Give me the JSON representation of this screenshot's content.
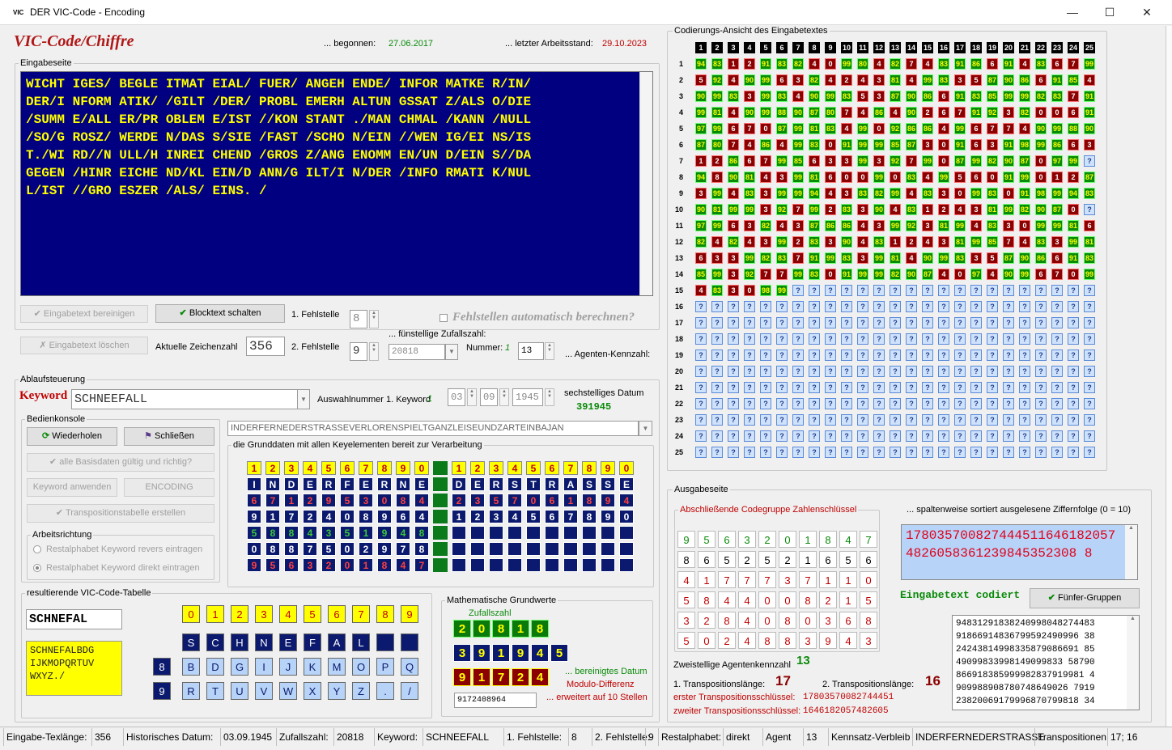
{
  "window": {
    "logo": "VIC",
    "title": "DER VIC-Code - Encoding"
  },
  "header": {
    "app_title": "VIC-Code/Chiffre",
    "begun_label": "... begonnen:",
    "begun_date": "27.06.2017",
    "last_label": "... letzter Arbeitsstand:",
    "last_date": "29.10.2023"
  },
  "input": {
    "group_label": "Eingabeseite",
    "lines": [
      "WICHT IGES/ BEGLE ITMAT EIAL/ FUER/ ANGEH ENDE/ INFOR MATKE R/IN/",
      "DER/I NFORM ATIK/ /GILT /DER/ PROBL EMERH ALTUN GSSAT Z/ALS O/DIE",
      "/SUMM E/ALL ER/PR OBLEM E/IST //KON STANT ./MAN CHMAL /KANN /NULL",
      "/SO/G ROSZ/ WERDE N/DAS S/SIE /FAST /SCHO N/EIN //WEN IG/EI NS/IS",
      "T./WI RD//N ULL/H INREI CHEND /GROS Z/ANG ENOMM EN/UN D/EIN S//DA",
      "GEGEN /HINR EICHE ND/KL EIN/D ANN/G ILT/I N/DER /INFO RMATI K/NUL",
      "L/IST //GRO ESZER /ALS/ EINS. /"
    ]
  },
  "controls": {
    "clean_btn": "Eingabetext bereinigen",
    "block_btn": "Blocktext schalten",
    "delete_btn": "Eingabetext löschen",
    "count_label": "Aktuelle Zeichenzahl",
    "count_value": "356",
    "err1_label": "1. Fehlstelle",
    "err1_value": "8",
    "err2_label": "2. Fehlstelle",
    "err2_value": "9",
    "auto_label": "Fehlstellen automatisch berechnen?",
    "random_label": "... fünstellige Zufallszahl:",
    "random_value": "20818",
    "number_label": "Nummer:",
    "number_value": "1",
    "agent_value": "13",
    "agent_label": "... Agenten-Kennzahl:"
  },
  "flow": {
    "group_label": "Ablaufsteuerung",
    "keyword_label": "Keyword",
    "keyword_value": "SCHNEEFALL",
    "select_label": "Auswahlnummer 1. Keyword",
    "select_value": "1",
    "date_d": "03",
    "date_m": "09",
    "date_y": "1945",
    "date_label": "sechstelliges Datum",
    "date_code": "391945",
    "phrase": "INDERFERNEDERSTRASSEVERLORENSPIELTGANZLEISEUNDZARTEINBAJAN"
  },
  "console": {
    "group_label": "Bedienkonsole",
    "repeat_btn": "Wiederholen",
    "close_btn": "Schließen",
    "check_btn": "alle Basisdaten gültig und richtig?",
    "apply_btn": "Keyword anwenden",
    "encode_btn": "ENCODING",
    "trans_btn": "Transpositionstabelle erstellen",
    "dir_label": "Arbeitsrichtung",
    "dir_rev": "Restalphabet Keyword revers eintragen",
    "dir_fwd": "Restalphabet Keyword direkt eintragen"
  },
  "basedata": {
    "label": "die Grunddaten mit allen Keyelementen bereit zur Verarbeitung",
    "rows": [
      [
        "1",
        "2",
        "3",
        "4",
        "5",
        "6",
        "7",
        "8",
        "9",
        "0",
        "",
        "1",
        "2",
        "3",
        "4",
        "5",
        "6",
        "7",
        "8",
        "9",
        "0"
      ],
      [
        "I",
        "N",
        "D",
        "E",
        "R",
        "F",
        "E",
        "R",
        "N",
        "E",
        "",
        "D",
        "E",
        "R",
        "S",
        "T",
        "R",
        "A",
        "S",
        "S",
        "E"
      ],
      [
        "6",
        "7",
        "1",
        "2",
        "9",
        "5",
        "3",
        "0",
        "8",
        "4",
        "",
        "2",
        "3",
        "5",
        "7",
        "0",
        "6",
        "1",
        "8",
        "9",
        "4"
      ],
      [
        "9",
        "1",
        "7",
        "2",
        "4",
        "0",
        "8",
        "9",
        "6",
        "4",
        "",
        "1",
        "2",
        "3",
        "4",
        "5",
        "6",
        "7",
        "8",
        "9",
        "0"
      ],
      [
        "5",
        "8",
        "8",
        "4",
        "3",
        "5",
        "1",
        "9",
        "4",
        "8",
        "",
        "",
        "",
        "",
        "",
        "",
        "",
        "",
        "",
        "",
        ""
      ],
      [
        "0",
        "8",
        "8",
        "7",
        "5",
        "0",
        "2",
        "9",
        "7",
        "8",
        "",
        "",
        "",
        "",
        "",
        "",
        "",
        "",
        "",
        "",
        ""
      ],
      [
        "9",
        "5",
        "6",
        "3",
        "2",
        "0",
        "1",
        "8",
        "4",
        "7",
        "",
        "",
        "",
        "",
        "",
        "",
        "",
        "",
        "",
        "",
        ""
      ]
    ]
  },
  "victable": {
    "group_label": "resultierende VIC-Code-Tabelle",
    "keyword": "SCHNEFAL",
    "alphabet": "SCHNEFALBDG IJKMOPQRTUV WXYZ./",
    "digits": [
      "0",
      "1",
      "2",
      "3",
      "4",
      "5",
      "6",
      "7",
      "8",
      "9"
    ],
    "row1": [
      "S",
      "C",
      "H",
      "N",
      "E",
      "F",
      "A",
      "L",
      "",
      ""
    ],
    "row2_num": "8",
    "row2": [
      "B",
      "D",
      "G",
      "I",
      "J",
      "K",
      "M",
      "O",
      "P",
      "Q"
    ],
    "row3_num": "9",
    "row3": [
      "R",
      "T",
      "U",
      "V",
      "W",
      "X",
      "Y",
      "Z",
      ".",
      "/"
    ]
  },
  "math": {
    "group_label": "Mathematische Grundwerte",
    "random_label": "Zufallszahl",
    "row1": [
      "2",
      "0",
      "8",
      "1",
      "8"
    ],
    "row2": [
      "3",
      "9",
      "1",
      "9",
      "4",
      "5"
    ],
    "row3": [
      "9",
      "1",
      "7",
      "2",
      "4"
    ],
    "cleaned_label": "... bereinigtes Datum",
    "modulo_label": "Modulo-Differenz",
    "extended_value": "9172408964",
    "extended_label": "... erweitert auf 10 Stellen"
  },
  "coding": {
    "group_label": "Codierungs-Ansicht des Eingabetextes",
    "headers": [
      "1",
      "2",
      "3",
      "4",
      "5",
      "6",
      "7",
      "8",
      "9",
      "10",
      "11",
      "12",
      "13",
      "14",
      "15",
      "16",
      "17",
      "18",
      "19",
      "20",
      "21",
      "22",
      "23",
      "24",
      "25"
    ],
    "row_nums": [
      "1",
      "2",
      "3",
      "4",
      "5",
      "6",
      "7",
      "8",
      "9",
      "10",
      "11",
      "12",
      "13",
      "14",
      "15",
      "16",
      "17",
      "18",
      "19",
      "20",
      "21",
      "22",
      "23",
      "24",
      "25"
    ],
    "rows": [
      "94 83 1 2 91 83 82 4 0 99 80 4 82 7 4 83 91 86 6 91 4 83 6 7 99",
      "5 92 4 90 99 6 3 82 4 2 4 3 81 4 99 83 3 5 87 90 86 6 91 85 4",
      "90 99 83 3 99 83 4 90 99 83 5 3 87 90 86 6 91 83 85 99 99 82 83 7 91",
      "99 81 4 90 99 88 90 87 80 7 4 86 4 90 2 6 7 91 92 3 82 0 0 6 91",
      "97 99 6 7 0 87 99 81 83 4 99 0 92 86 86 4 99 6 7 7 4 90 99 88 90",
      "87 80 7 4 86 4 99 83 0 91 99 99 85 87 3 0 91 6 3 91 98 99 86 6 3",
      "1 2 86 6 7 99 85 6 3 3 99 3 92 7 99 0 87 99 82 90 87 0 97 99",
      "94 8 90 81 4 3 99 81 6 0 0 99 0 83 4 99 5 6 0 91 99 0 1 2 87",
      "3 99 4 83 3 99 99 94 4 3 83 82 99 4 83 3 0 99 83 0 91 98 99 94 83",
      "90 81 99 99 3 92 7 99 2 83 3 90 4 83 1 2 4 3 81 99 82 90 87 0",
      "97 99 6 3 82 4 3 87 86 86 4 3 99 92 3 81 99 4 83 3 0 99 99 81 6",
      "82 4 82 4 3 99 2 83 3 90 4 83 1 2 4 3 81 99 85 7 4 83 3 99 81",
      "6 3 3 99 82 83 7 91 99 83 3 99 81 4 90 99 83 3 5 87 90 86 6 91 83",
      "85 99 3 92 7 7 99 83 0 91 99 99 82 90 87 4 0 97 4 90 99 6 7 0 99",
      "4 83 3 0 98 99"
    ],
    "unknown_glyph": "?"
  },
  "output": {
    "group_label": "Ausgabeseite",
    "final_label": "Abschließende Codegruppe Zahlenschlüssel",
    "final_rows": [
      [
        "9",
        "5",
        "6",
        "3",
        "2",
        "0",
        "1",
        "8",
        "4",
        "7"
      ],
      [
        "8",
        "6",
        "5",
        "2",
        "5",
        "2",
        "1",
        "6",
        "5",
        "6"
      ],
      [
        "4",
        "1",
        "7",
        "7",
        "7",
        "3",
        "7",
        "1",
        "1",
        "0"
      ],
      [
        "5",
        "8",
        "4",
        "4",
        "0",
        "0",
        "8",
        "2",
        "1",
        "5"
      ],
      [
        "3",
        "2",
        "8",
        "4",
        "0",
        "8",
        "0",
        "3",
        "6",
        "8"
      ],
      [
        "5",
        "0",
        "2",
        "4",
        "8",
        "8",
        "3",
        "9",
        "4",
        "3"
      ]
    ],
    "sorted_label": "... spaltenweise sortiert ausgelesene Ziffernfolge (0 = 10)",
    "sorted_digits": "1780357008274445116461820574826058361239845352308 8",
    "encoded_label": "Eingabetext codiert",
    "five_btn": "Fünfer-Gruppen",
    "agent_label": "Zweistellige Agentenkennzahl",
    "agent_value": "13",
    "t1_label": "1. Transpositionslänge:",
    "t1_value": "17",
    "t2_label": "2. Transpositionslänge:",
    "t2_value": "16",
    "k1_label": "erster Transpositionsschlüssel:",
    "k1_value": "17803570082744451",
    "k2_label": "zweiter Transpositionsschlüssel:",
    "k2_value": "1646182057482605",
    "groups": [
      "94831291838240998048274483",
      "91866914836799592490996 38",
      "24243814998335879086691 85",
      "49099833998149099833 58790",
      "866918385999982837919981 4",
      "909988908780748649026 7919",
      "23820069179996870799818 34"
    ]
  },
  "status": [
    [
      "Eingabe-Texlänge:",
      "356"
    ],
    [
      "Historisches Datum:",
      "03.09.1945"
    ],
    [
      "Zufallszahl:",
      "20818"
    ],
    [
      "Keyword:",
      "SCHNEEFALL"
    ],
    [
      "1. Fehlstelle:",
      "8"
    ],
    [
      "2. Fehlstelle:",
      "9"
    ],
    [
      "Restalphabet:",
      "direkt"
    ],
    [
      "Agent",
      "13"
    ],
    [
      "Kennsatz-Verbleib",
      "INDERFERNEDERSTRASSE"
    ],
    [
      "Transpositionen",
      "17; 16"
    ]
  ]
}
